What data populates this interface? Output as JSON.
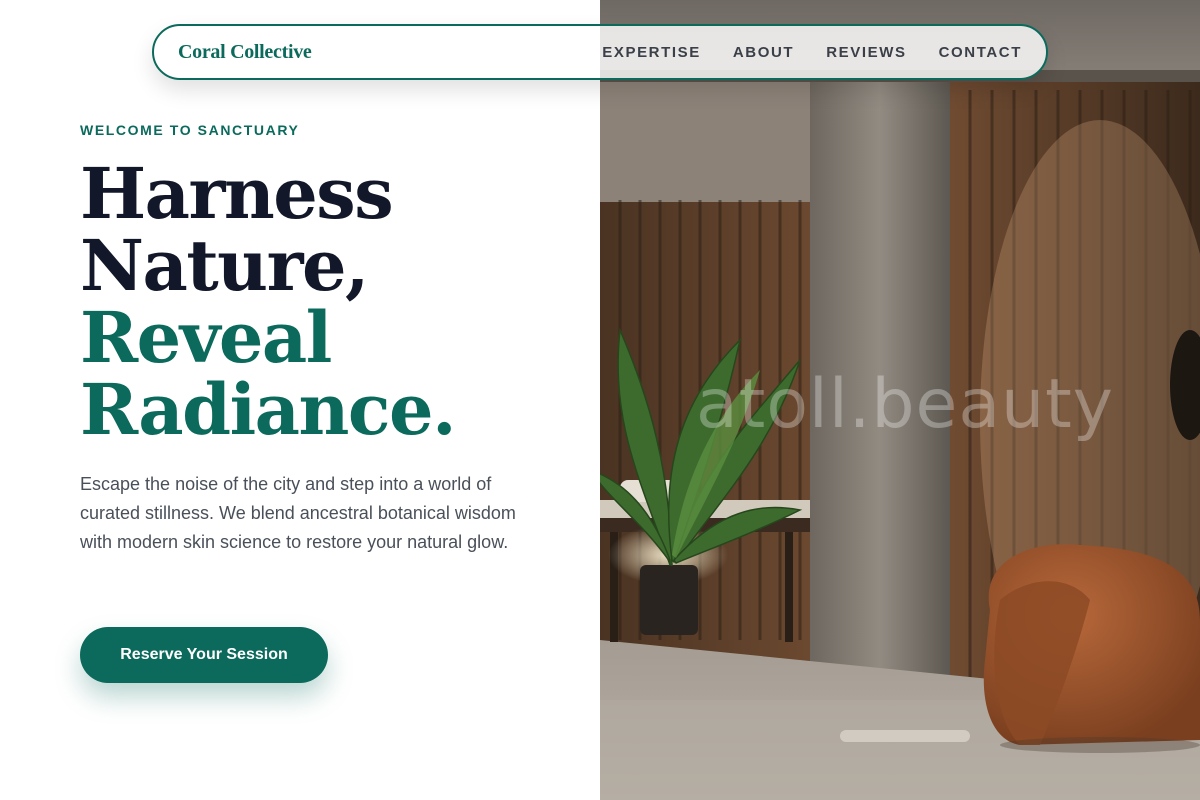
{
  "brand": {
    "name": "Coral Collective"
  },
  "nav": {
    "links": [
      "EXPERTISE",
      "ABOUT",
      "REVIEWS",
      "CONTACT"
    ]
  },
  "hero": {
    "eyebrow": "WELCOME TO SANCTUARY",
    "headline": {
      "line1": "Harness",
      "line2": "Nature,",
      "line3": "Reveal",
      "line4": "Radiance."
    },
    "lead": "Escape the noise of the city and step into a world of curated stillness. We blend ancestral botanical wisdom with modern skin science to restore your natural glow.",
    "cta_label": "Reserve Your Session"
  },
  "photo": {
    "watermark": "atoll.beauty"
  },
  "colors": {
    "accent": "#0b6a5c",
    "heading": "#121829",
    "body_text": "#4a505a",
    "nav_text": "#3a3f48"
  }
}
